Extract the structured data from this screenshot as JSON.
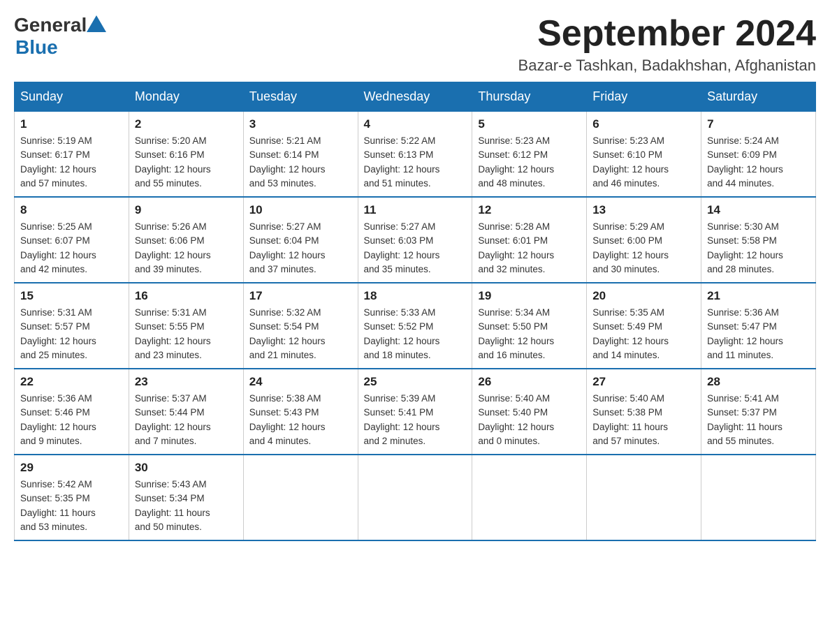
{
  "header": {
    "logo_general": "General",
    "logo_blue": "Blue",
    "month_title": "September 2024",
    "location": "Bazar-e Tashkan, Badakhshan, Afghanistan"
  },
  "days_of_week": [
    "Sunday",
    "Monday",
    "Tuesday",
    "Wednesday",
    "Thursday",
    "Friday",
    "Saturday"
  ],
  "weeks": [
    [
      {
        "day": "1",
        "sunrise": "5:19 AM",
        "sunset": "6:17 PM",
        "daylight": "12 hours and 57 minutes."
      },
      {
        "day": "2",
        "sunrise": "5:20 AM",
        "sunset": "6:16 PM",
        "daylight": "12 hours and 55 minutes."
      },
      {
        "day": "3",
        "sunrise": "5:21 AM",
        "sunset": "6:14 PM",
        "daylight": "12 hours and 53 minutes."
      },
      {
        "day": "4",
        "sunrise": "5:22 AM",
        "sunset": "6:13 PM",
        "daylight": "12 hours and 51 minutes."
      },
      {
        "day": "5",
        "sunrise": "5:23 AM",
        "sunset": "6:12 PM",
        "daylight": "12 hours and 48 minutes."
      },
      {
        "day": "6",
        "sunrise": "5:23 AM",
        "sunset": "6:10 PM",
        "daylight": "12 hours and 46 minutes."
      },
      {
        "day": "7",
        "sunrise": "5:24 AM",
        "sunset": "6:09 PM",
        "daylight": "12 hours and 44 minutes."
      }
    ],
    [
      {
        "day": "8",
        "sunrise": "5:25 AM",
        "sunset": "6:07 PM",
        "daylight": "12 hours and 42 minutes."
      },
      {
        "day": "9",
        "sunrise": "5:26 AM",
        "sunset": "6:06 PM",
        "daylight": "12 hours and 39 minutes."
      },
      {
        "day": "10",
        "sunrise": "5:27 AM",
        "sunset": "6:04 PM",
        "daylight": "12 hours and 37 minutes."
      },
      {
        "day": "11",
        "sunrise": "5:27 AM",
        "sunset": "6:03 PM",
        "daylight": "12 hours and 35 minutes."
      },
      {
        "day": "12",
        "sunrise": "5:28 AM",
        "sunset": "6:01 PM",
        "daylight": "12 hours and 32 minutes."
      },
      {
        "day": "13",
        "sunrise": "5:29 AM",
        "sunset": "6:00 PM",
        "daylight": "12 hours and 30 minutes."
      },
      {
        "day": "14",
        "sunrise": "5:30 AM",
        "sunset": "5:58 PM",
        "daylight": "12 hours and 28 minutes."
      }
    ],
    [
      {
        "day": "15",
        "sunrise": "5:31 AM",
        "sunset": "5:57 PM",
        "daylight": "12 hours and 25 minutes."
      },
      {
        "day": "16",
        "sunrise": "5:31 AM",
        "sunset": "5:55 PM",
        "daylight": "12 hours and 23 minutes."
      },
      {
        "day": "17",
        "sunrise": "5:32 AM",
        "sunset": "5:54 PM",
        "daylight": "12 hours and 21 minutes."
      },
      {
        "day": "18",
        "sunrise": "5:33 AM",
        "sunset": "5:52 PM",
        "daylight": "12 hours and 18 minutes."
      },
      {
        "day": "19",
        "sunrise": "5:34 AM",
        "sunset": "5:50 PM",
        "daylight": "12 hours and 16 minutes."
      },
      {
        "day": "20",
        "sunrise": "5:35 AM",
        "sunset": "5:49 PM",
        "daylight": "12 hours and 14 minutes."
      },
      {
        "day": "21",
        "sunrise": "5:36 AM",
        "sunset": "5:47 PM",
        "daylight": "12 hours and 11 minutes."
      }
    ],
    [
      {
        "day": "22",
        "sunrise": "5:36 AM",
        "sunset": "5:46 PM",
        "daylight": "12 hours and 9 minutes."
      },
      {
        "day": "23",
        "sunrise": "5:37 AM",
        "sunset": "5:44 PM",
        "daylight": "12 hours and 7 minutes."
      },
      {
        "day": "24",
        "sunrise": "5:38 AM",
        "sunset": "5:43 PM",
        "daylight": "12 hours and 4 minutes."
      },
      {
        "day": "25",
        "sunrise": "5:39 AM",
        "sunset": "5:41 PM",
        "daylight": "12 hours and 2 minutes."
      },
      {
        "day": "26",
        "sunrise": "5:40 AM",
        "sunset": "5:40 PM",
        "daylight": "12 hours and 0 minutes."
      },
      {
        "day": "27",
        "sunrise": "5:40 AM",
        "sunset": "5:38 PM",
        "daylight": "11 hours and 57 minutes."
      },
      {
        "day": "28",
        "sunrise": "5:41 AM",
        "sunset": "5:37 PM",
        "daylight": "11 hours and 55 minutes."
      }
    ],
    [
      {
        "day": "29",
        "sunrise": "5:42 AM",
        "sunset": "5:35 PM",
        "daylight": "11 hours and 53 minutes."
      },
      {
        "day": "30",
        "sunrise": "5:43 AM",
        "sunset": "5:34 PM",
        "daylight": "11 hours and 50 minutes."
      },
      null,
      null,
      null,
      null,
      null
    ]
  ],
  "labels": {
    "sunrise": "Sunrise:",
    "sunset": "Sunset:",
    "daylight": "Daylight:"
  }
}
